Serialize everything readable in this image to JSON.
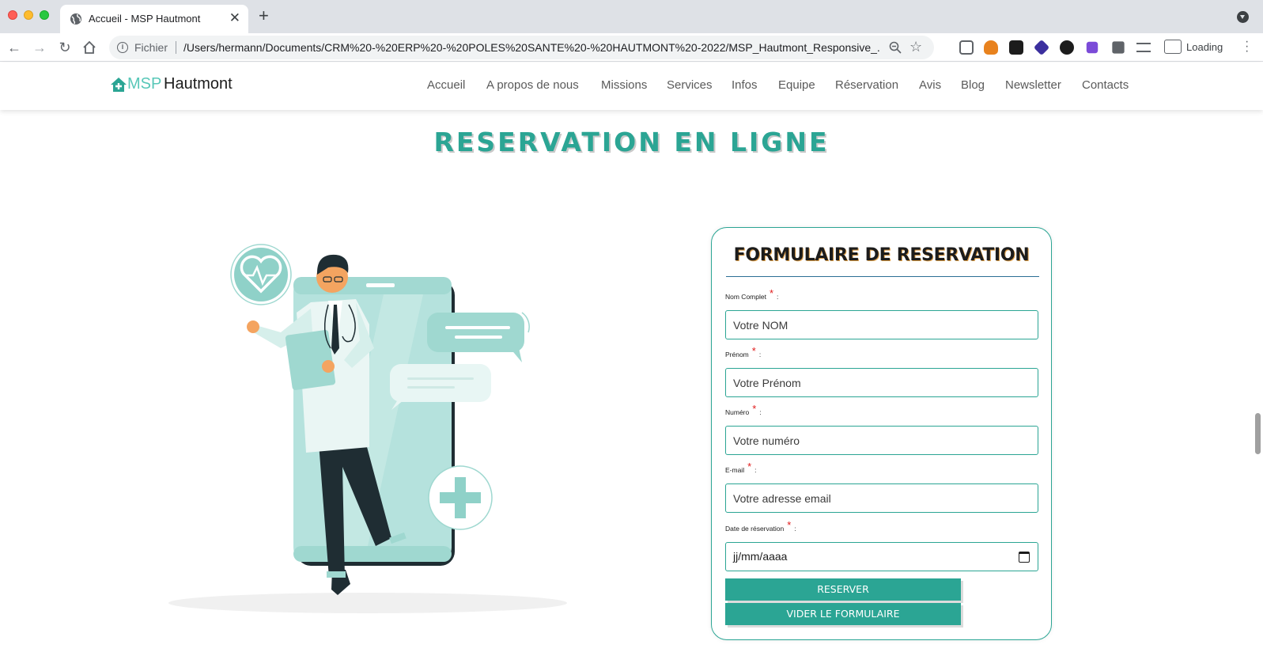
{
  "browser": {
    "tab_title": "Accueil - MSP Hautmont",
    "url_scheme": "Fichier",
    "url": "/Users/hermann/Documents/CRM%20-%20ERP%20-%20POLES%20SANTE%20-%20HAUTMONT%20-2022/MSP_Hautmont_Responsive_...",
    "profile_label": "Loading"
  },
  "site": {
    "logo_prefix": "MSP",
    "logo_name": "Hautmont",
    "brand_color": "#2ba594",
    "nav": [
      "Accueil",
      "A propos de nous",
      "Missions",
      "Services",
      "Infos",
      "Equipe",
      "Réservation",
      "Avis",
      "Blog",
      "Newsletter",
      "Contacts"
    ]
  },
  "page": {
    "title": "RESERVATION EN LIGNE"
  },
  "form": {
    "title": "FORMULAIRE DE RESERVATION",
    "required_mark": "*",
    "colon": ":",
    "fields": [
      {
        "label": "Nom Complet",
        "placeholder": "Votre NOM"
      },
      {
        "label": "Prénom",
        "placeholder": "Votre Prénom"
      },
      {
        "label": "Numéro",
        "placeholder": "Votre numéro"
      },
      {
        "label": "E-mail",
        "placeholder": "Votre adresse email"
      },
      {
        "label": "Date de réservation",
        "placeholder": "jj/mm/aaaa"
      }
    ],
    "submit_label": "RESERVER",
    "reset_label": "VIDER LE FORMULAIRE"
  }
}
